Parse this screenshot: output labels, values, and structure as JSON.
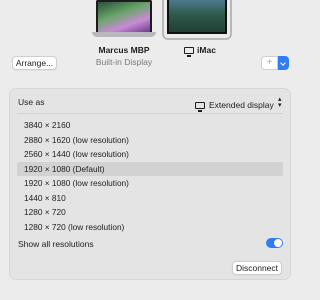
{
  "displays": [
    {
      "name": "Marcus MBP",
      "subtitle": "Built-in Display"
    },
    {
      "name": "iMac"
    }
  ],
  "toolbar": {
    "arrange_label": "Arrange...",
    "add_label": "+"
  },
  "settings": {
    "use_as_label": "Use as",
    "use_as_value": "Extended display",
    "resolutions": [
      {
        "label": "3840 × 2160"
      },
      {
        "label": "2880 × 1620 (low resolution)"
      },
      {
        "label": "2560 × 1440 (low resolution)"
      },
      {
        "label": "1920 × 1080 (Default)",
        "selected": true
      },
      {
        "label": "1920 × 1080 (low resolution)"
      },
      {
        "label": "1440 × 810"
      },
      {
        "label": "1280 × 720"
      },
      {
        "label": "1280 × 720 (low resolution)"
      }
    ],
    "show_all_label": "Show all resolutions",
    "show_all_on": true,
    "disconnect_label": "Disconnect"
  },
  "colors": {
    "accent": "#2f7cf6",
    "background": "#ececec",
    "panel": "#e4e4e4",
    "selected_row": "#d2d2d2"
  },
  "icons": {
    "display": "display-icon",
    "updown": "up-down-chevron-icon",
    "dropdown": "chevron-down-icon"
  }
}
